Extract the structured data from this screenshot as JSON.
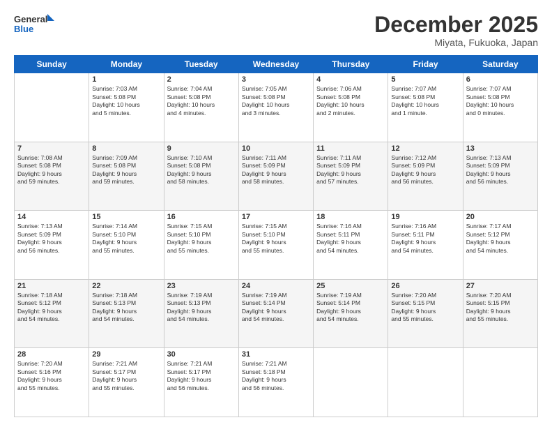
{
  "header": {
    "logo_line1": "General",
    "logo_line2": "Blue",
    "month": "December 2025",
    "location": "Miyata, Fukuoka, Japan"
  },
  "weekdays": [
    "Sunday",
    "Monday",
    "Tuesday",
    "Wednesday",
    "Thursday",
    "Friday",
    "Saturday"
  ],
  "rows": [
    [
      {
        "num": "",
        "info": ""
      },
      {
        "num": "1",
        "info": "Sunrise: 7:03 AM\nSunset: 5:08 PM\nDaylight: 10 hours\nand 5 minutes."
      },
      {
        "num": "2",
        "info": "Sunrise: 7:04 AM\nSunset: 5:08 PM\nDaylight: 10 hours\nand 4 minutes."
      },
      {
        "num": "3",
        "info": "Sunrise: 7:05 AM\nSunset: 5:08 PM\nDaylight: 10 hours\nand 3 minutes."
      },
      {
        "num": "4",
        "info": "Sunrise: 7:06 AM\nSunset: 5:08 PM\nDaylight: 10 hours\nand 2 minutes."
      },
      {
        "num": "5",
        "info": "Sunrise: 7:07 AM\nSunset: 5:08 PM\nDaylight: 10 hours\nand 1 minute."
      },
      {
        "num": "6",
        "info": "Sunrise: 7:07 AM\nSunset: 5:08 PM\nDaylight: 10 hours\nand 0 minutes."
      }
    ],
    [
      {
        "num": "7",
        "info": "Sunrise: 7:08 AM\nSunset: 5:08 PM\nDaylight: 9 hours\nand 59 minutes."
      },
      {
        "num": "8",
        "info": "Sunrise: 7:09 AM\nSunset: 5:08 PM\nDaylight: 9 hours\nand 59 minutes."
      },
      {
        "num": "9",
        "info": "Sunrise: 7:10 AM\nSunset: 5:08 PM\nDaylight: 9 hours\nand 58 minutes."
      },
      {
        "num": "10",
        "info": "Sunrise: 7:11 AM\nSunset: 5:09 PM\nDaylight: 9 hours\nand 58 minutes."
      },
      {
        "num": "11",
        "info": "Sunrise: 7:11 AM\nSunset: 5:09 PM\nDaylight: 9 hours\nand 57 minutes."
      },
      {
        "num": "12",
        "info": "Sunrise: 7:12 AM\nSunset: 5:09 PM\nDaylight: 9 hours\nand 56 minutes."
      },
      {
        "num": "13",
        "info": "Sunrise: 7:13 AM\nSunset: 5:09 PM\nDaylight: 9 hours\nand 56 minutes."
      }
    ],
    [
      {
        "num": "14",
        "info": "Sunrise: 7:13 AM\nSunset: 5:09 PM\nDaylight: 9 hours\nand 56 minutes."
      },
      {
        "num": "15",
        "info": "Sunrise: 7:14 AM\nSunset: 5:10 PM\nDaylight: 9 hours\nand 55 minutes."
      },
      {
        "num": "16",
        "info": "Sunrise: 7:15 AM\nSunset: 5:10 PM\nDaylight: 9 hours\nand 55 minutes."
      },
      {
        "num": "17",
        "info": "Sunrise: 7:15 AM\nSunset: 5:10 PM\nDaylight: 9 hours\nand 55 minutes."
      },
      {
        "num": "18",
        "info": "Sunrise: 7:16 AM\nSunset: 5:11 PM\nDaylight: 9 hours\nand 54 minutes."
      },
      {
        "num": "19",
        "info": "Sunrise: 7:16 AM\nSunset: 5:11 PM\nDaylight: 9 hours\nand 54 minutes."
      },
      {
        "num": "20",
        "info": "Sunrise: 7:17 AM\nSunset: 5:12 PM\nDaylight: 9 hours\nand 54 minutes."
      }
    ],
    [
      {
        "num": "21",
        "info": "Sunrise: 7:18 AM\nSunset: 5:12 PM\nDaylight: 9 hours\nand 54 minutes."
      },
      {
        "num": "22",
        "info": "Sunrise: 7:18 AM\nSunset: 5:13 PM\nDaylight: 9 hours\nand 54 minutes."
      },
      {
        "num": "23",
        "info": "Sunrise: 7:19 AM\nSunset: 5:13 PM\nDaylight: 9 hours\nand 54 minutes."
      },
      {
        "num": "24",
        "info": "Sunrise: 7:19 AM\nSunset: 5:14 PM\nDaylight: 9 hours\nand 54 minutes."
      },
      {
        "num": "25",
        "info": "Sunrise: 7:19 AM\nSunset: 5:14 PM\nDaylight: 9 hours\nand 54 minutes."
      },
      {
        "num": "26",
        "info": "Sunrise: 7:20 AM\nSunset: 5:15 PM\nDaylight: 9 hours\nand 55 minutes."
      },
      {
        "num": "27",
        "info": "Sunrise: 7:20 AM\nSunset: 5:15 PM\nDaylight: 9 hours\nand 55 minutes."
      }
    ],
    [
      {
        "num": "28",
        "info": "Sunrise: 7:20 AM\nSunset: 5:16 PM\nDaylight: 9 hours\nand 55 minutes."
      },
      {
        "num": "29",
        "info": "Sunrise: 7:21 AM\nSunset: 5:17 PM\nDaylight: 9 hours\nand 55 minutes."
      },
      {
        "num": "30",
        "info": "Sunrise: 7:21 AM\nSunset: 5:17 PM\nDaylight: 9 hours\nand 56 minutes."
      },
      {
        "num": "31",
        "info": "Sunrise: 7:21 AM\nSunset: 5:18 PM\nDaylight: 9 hours\nand 56 minutes."
      },
      {
        "num": "",
        "info": ""
      },
      {
        "num": "",
        "info": ""
      },
      {
        "num": "",
        "info": ""
      }
    ]
  ]
}
